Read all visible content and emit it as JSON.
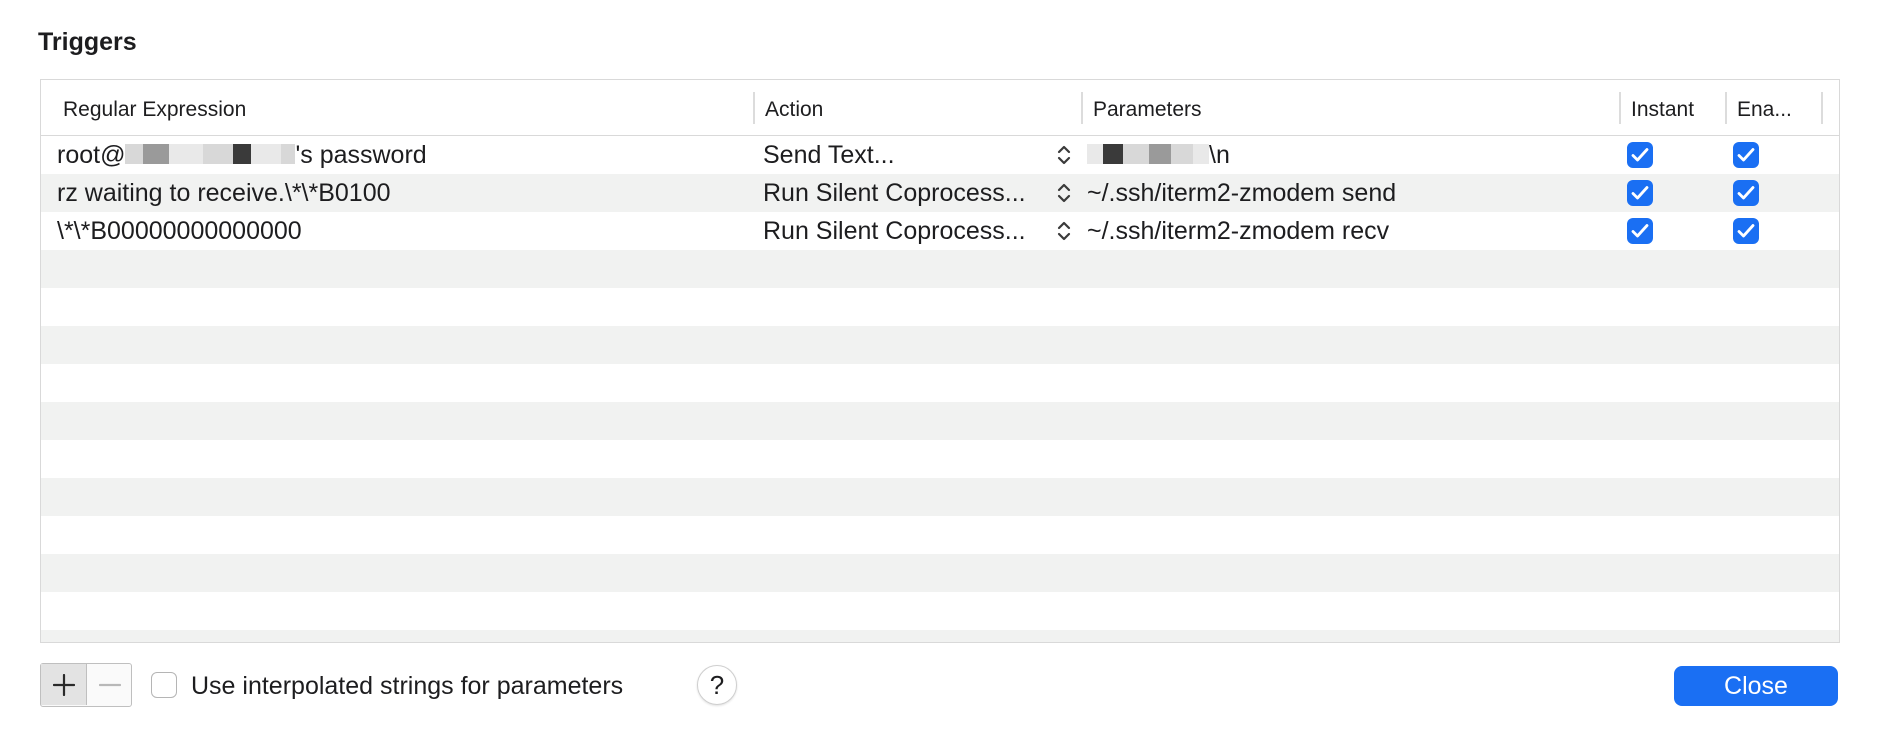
{
  "dialog": {
    "title": "Triggers"
  },
  "table": {
    "columns": [
      {
        "key": "regex",
        "label": "Regular Expression"
      },
      {
        "key": "action",
        "label": "Action"
      },
      {
        "key": "parameters",
        "label": "Parameters"
      },
      {
        "key": "instant",
        "label": "Instant"
      },
      {
        "key": "enabled",
        "label": "Ena..."
      }
    ],
    "rows": [
      {
        "regex_prefix": "root@",
        "regex_redacted": true,
        "regex_suffix": "'s password",
        "action": "Send Text...",
        "parameters_redacted": true,
        "parameters_suffix": "\\n",
        "instant": true,
        "enabled": true
      },
      {
        "regex": "rz waiting to receive.\\*\\*B0100",
        "action": "Run Silent Coprocess...",
        "parameters": "~/.ssh/iterm2-zmodem send",
        "instant": true,
        "enabled": true
      },
      {
        "regex": "\\*\\*B00000000000000",
        "action": "Run Silent Coprocess...",
        "parameters": "~/.ssh/iterm2-zmodem recv",
        "instant": true,
        "enabled": true
      }
    ]
  },
  "footer": {
    "add_label": "+",
    "remove_label": "−",
    "interpolated_label": "Use interpolated strings for parameters",
    "interpolated_checked": false,
    "help_label": "?",
    "close_label": "Close"
  },
  "icons": {
    "add": "plus-icon",
    "remove": "minus-icon",
    "stepper": "up-down-chevron-icon",
    "checkmark": "checkmark-icon",
    "help": "question-mark-icon"
  },
  "colors": {
    "accent": "#1a6ff3",
    "row_alt": "#f1f2f1",
    "border": "#d9d9d9"
  }
}
